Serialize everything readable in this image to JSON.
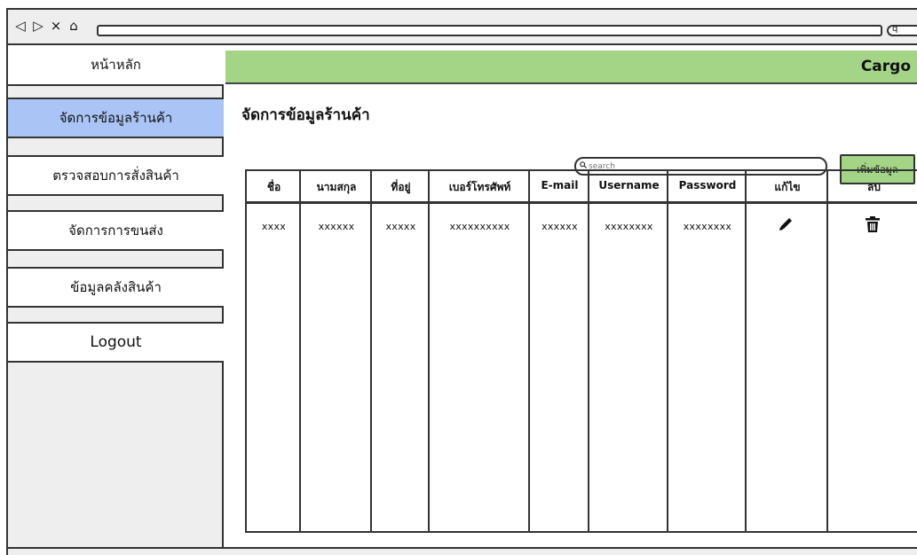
{
  "browser": {
    "nav_icons": {
      "back": "◁",
      "forward": "▷",
      "close": "×",
      "home": "⌂"
    },
    "url_end_icon": "q"
  },
  "sidebar": {
    "items": [
      {
        "label": "หน้าหลัก",
        "active": false
      },
      {
        "label": "จัดการข้อมูลร้านค้า",
        "active": true
      },
      {
        "label": "ตรวจสอบการสั่งสินค้า",
        "active": false
      },
      {
        "label": "จัดการการขนส่ง",
        "active": false
      },
      {
        "label": "ข้อมูลคลังสินค้า",
        "active": false
      },
      {
        "label": "Logout",
        "active": false
      }
    ]
  },
  "header": {
    "brand": "Cargo",
    "accent_color": "#a4d486"
  },
  "main": {
    "title": "จัดการข้อมูลร้านค้า",
    "search": {
      "placeholder": "search",
      "icon": "search-icon"
    },
    "add_button": "เพิ่มข้อมูล"
  },
  "table": {
    "columns": [
      "ชื่อ",
      "นามสกุล",
      "ที่อยู่",
      "เบอร์โทรศัพท์",
      "E-mail",
      "Username",
      "Password",
      "แก้ไข",
      "ลบ"
    ],
    "rows": [
      [
        "xxxx",
        "xxxxxx",
        "xxxxx",
        "xxxxxxxxxx",
        "xxxxxx",
        "xxxxxxxx",
        "xxxxxxxx"
      ]
    ],
    "row_actions": {
      "edit_icon": "pencil-icon",
      "delete_icon": "trash-icon"
    }
  },
  "colors": {
    "active_item": "#a9c4f5",
    "header_green": "#a4d486"
  }
}
